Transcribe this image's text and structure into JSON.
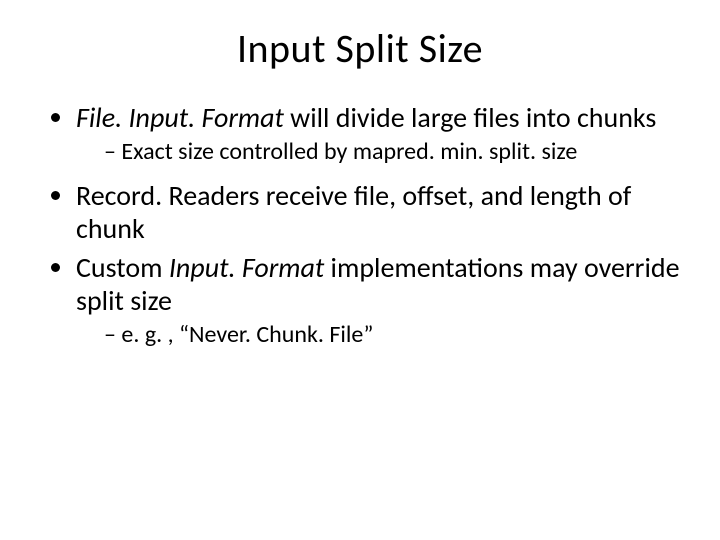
{
  "title": "Input Split Size",
  "bullets": {
    "b1_prefix_italic": "File. Input. Format",
    "b1_rest": " will divide large files into chunks",
    "b1_sub1": "Exact size controlled by mapred. min. split. size",
    "b2": "Record. Readers receive file, offset, and length of chunk",
    "b3_prefix": "Custom ",
    "b3_italic": "Input. Format",
    "b3_rest": " implementations may override split size",
    "b3_sub1": "e. g. , “Never. Chunk. File”"
  }
}
